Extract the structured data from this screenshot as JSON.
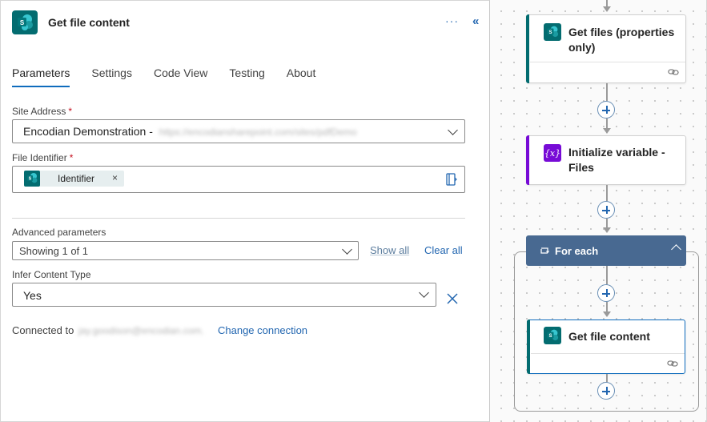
{
  "panel": {
    "title": "Get file content",
    "more_label": "···",
    "collapse_label": "«",
    "tabs": [
      {
        "label": "Parameters",
        "active": true
      },
      {
        "label": "Settings"
      },
      {
        "label": "Code View"
      },
      {
        "label": "Testing"
      },
      {
        "label": "About"
      }
    ],
    "site_address": {
      "label": "Site Address",
      "required_mark": "*",
      "value": "Encodian Demonstration -",
      "blurred_url": "https://encodiansharepoint.com/sites/pdfDemo"
    },
    "file_identifier": {
      "label": "File Identifier",
      "required_mark": "*",
      "token": "Identifier",
      "token_remove": "×"
    },
    "advanced": {
      "label": "Advanced parameters",
      "value": "Showing 1 of 1",
      "show_all": "Show all",
      "clear_all": "Clear all"
    },
    "infer_content_type": {
      "label": "Infer Content Type",
      "value": "Yes"
    },
    "connection": {
      "prefix": "Connected to",
      "blurred_account": "jay.goodison@encodian.com.",
      "change_label": "Change connection"
    }
  },
  "canvas": {
    "cards": [
      {
        "title_line1": "Get files (properties",
        "title_line2": "only)",
        "icon": "sharepoint-icon",
        "accent": "#036c70"
      },
      {
        "title_line1": "Initialize variable -",
        "title_line2": "Files",
        "icon": "variable-icon",
        "accent": "#770bd6"
      },
      {
        "title": "Get file content",
        "icon": "sharepoint-icon",
        "accent": "#036c70"
      }
    ],
    "foreach": {
      "title": "For each",
      "color": "#486991"
    }
  },
  "colors": {
    "link": "#2266b0",
    "sharepoint": "#036c70",
    "variable": "#770bd6",
    "required": "#c50f1f"
  }
}
